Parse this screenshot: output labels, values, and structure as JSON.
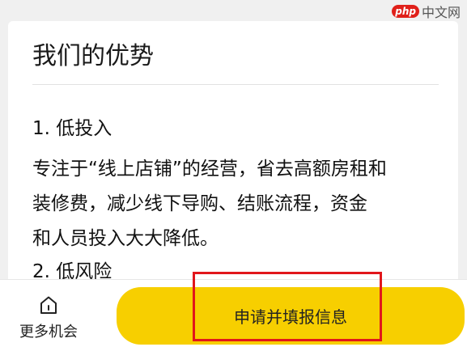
{
  "watermark": {
    "logo": "php",
    "site": "中文网"
  },
  "card": {
    "title": "我们的优势",
    "section1": {
      "heading": "1. 低投入",
      "lines": [
        "专注于“线上店铺”的经营，省去高额房租和",
        "装修费，减少线下导购、结账流程，资金",
        "和人员投入大大降低。"
      ]
    },
    "section2": {
      "heading": "2. 低风险"
    }
  },
  "bottom_bar": {
    "more_label": "更多机会",
    "more_icon": "home-icon",
    "apply_label": "申请并填报信息",
    "apply_color": "#f7cf00",
    "highlight_color": "#e1161b"
  }
}
